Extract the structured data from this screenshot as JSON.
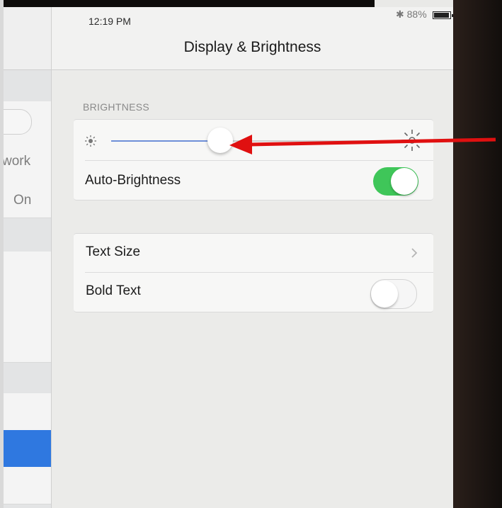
{
  "status_bar": {
    "time": "12:19 PM",
    "bluetooth_icon": "bluetooth-icon",
    "battery_percent": "88%",
    "battery_level": 0.88
  },
  "nav": {
    "title": "Display & Brightness"
  },
  "master": {
    "partial_items": [
      {
        "text": "work"
      },
      {
        "text": "On"
      }
    ],
    "selected_color": "#2f78e0"
  },
  "brightness": {
    "header": "BRIGHTNESS",
    "level": 0.34,
    "min_icon": "sun-small-icon",
    "max_icon": "sun-large-icon",
    "auto_brightness": {
      "label": "Auto-Brightness",
      "on": true
    }
  },
  "text_settings": {
    "text_size": {
      "label": "Text Size",
      "chevron_icon": "chevron-right-icon"
    },
    "bold_text": {
      "label": "Bold Text",
      "on": false
    }
  },
  "annotation": {
    "color": "#e01010",
    "icon": "red-arrow-icon"
  },
  "colors": {
    "switch_on": "#3fc659",
    "slider_fill": "#6e8fd8"
  }
}
